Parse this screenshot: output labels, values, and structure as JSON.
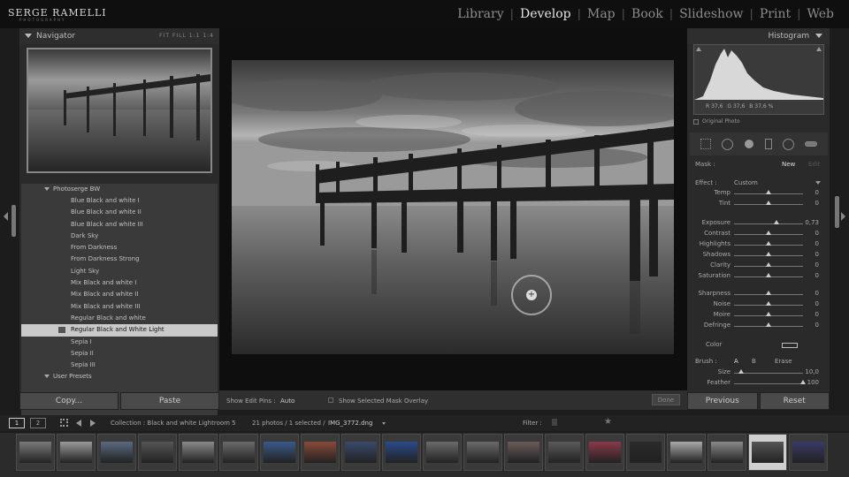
{
  "brand": {
    "logo_text": "SERGE RAMELLI",
    "logo_sub": "PHOTOGRAPHY"
  },
  "modules": [
    {
      "label": "Library",
      "active": false
    },
    {
      "label": "Develop",
      "active": true
    },
    {
      "label": "Map",
      "active": false
    },
    {
      "label": "Book",
      "active": false
    },
    {
      "label": "Slideshow",
      "active": false
    },
    {
      "label": "Print",
      "active": false
    },
    {
      "label": "Web",
      "active": false
    }
  ],
  "navigator": {
    "title": "Navigator",
    "zoom_options": [
      "FIT",
      "FILL",
      "1:1",
      "1:4"
    ]
  },
  "presets": {
    "folder": "Photoserge BW",
    "items": [
      "Blue Black and white I",
      "Blue Black and white II",
      "Blue Black and white III",
      "Dark Sky",
      "From Darkness",
      "From Darkness Strong",
      "Light Sky",
      "Mix Black and white I",
      "Mix Black and white II",
      "Mix Black and white III",
      "Regular Black and white",
      "Regular Black and White Light",
      "Sepia I",
      "Sepia II",
      "Sepia III"
    ],
    "selected_index": 11,
    "user_folder": "User Presets"
  },
  "left_buttons": {
    "copy": "Copy...",
    "paste": "Paste"
  },
  "toolbar": {
    "show_pins_label": "Show Edit Pins :",
    "show_pins_value": "Auto",
    "overlay_label": "Show Selected Mask Overlay",
    "done": "Done"
  },
  "histogram": {
    "title": "Histogram",
    "r_label": "R",
    "r_value": "37,6",
    "g_label": "G",
    "g_value": "37,6",
    "b_label": "B",
    "b_value": "37,6",
    "unit": "%",
    "original_photo": "Original Photo"
  },
  "mask": {
    "label": "Mask :",
    "new": "New",
    "edit": "Edit"
  },
  "effect": {
    "label": "Effect :",
    "value": "Custom"
  },
  "sliders": [
    {
      "label": "Temp",
      "value": "0",
      "pos": 0.5
    },
    {
      "label": "Tint",
      "value": "0",
      "pos": 0.5
    },
    {
      "label": "Exposure",
      "value": "0,73",
      "pos": 0.62
    },
    {
      "label": "Contrast",
      "value": "0",
      "pos": 0.5
    },
    {
      "label": "Highlights",
      "value": "0",
      "pos": 0.5
    },
    {
      "label": "Shadows",
      "value": "0",
      "pos": 0.5
    },
    {
      "label": "Clarity",
      "value": "0",
      "pos": 0.5
    },
    {
      "label": "Saturation",
      "value": "0",
      "pos": 0.5
    },
    {
      "label": "Sharpness",
      "value": "0",
      "pos": 0.5
    },
    {
      "label": "Noise",
      "value": "0",
      "pos": 0.5
    },
    {
      "label": "Moire",
      "value": "0",
      "pos": 0.5
    },
    {
      "label": "Defringe",
      "value": "0",
      "pos": 0.5
    }
  ],
  "color": {
    "label": "Color"
  },
  "brush": {
    "label": "Brush :",
    "a": "A",
    "b": "B",
    "erase": "Erase"
  },
  "brush_size": {
    "label": "Size",
    "value": "10,0",
    "pos": 0.1
  },
  "brush_feather": {
    "label": "Feather",
    "value": "100",
    "pos": 1.0
  },
  "right_buttons": {
    "previous": "Previous",
    "reset": "Reset"
  },
  "filmbar": {
    "page1": "1",
    "page2": "2",
    "collection": "Collection : Black and white Lightroom 5",
    "count": "21 photos / 1 selected /",
    "filename": "IMG_3772.dng",
    "filter": "Filter :"
  },
  "colors": {
    "accent": "#c9c9c9",
    "panel": "#2a2a2a",
    "background": "#0e0e0e"
  }
}
